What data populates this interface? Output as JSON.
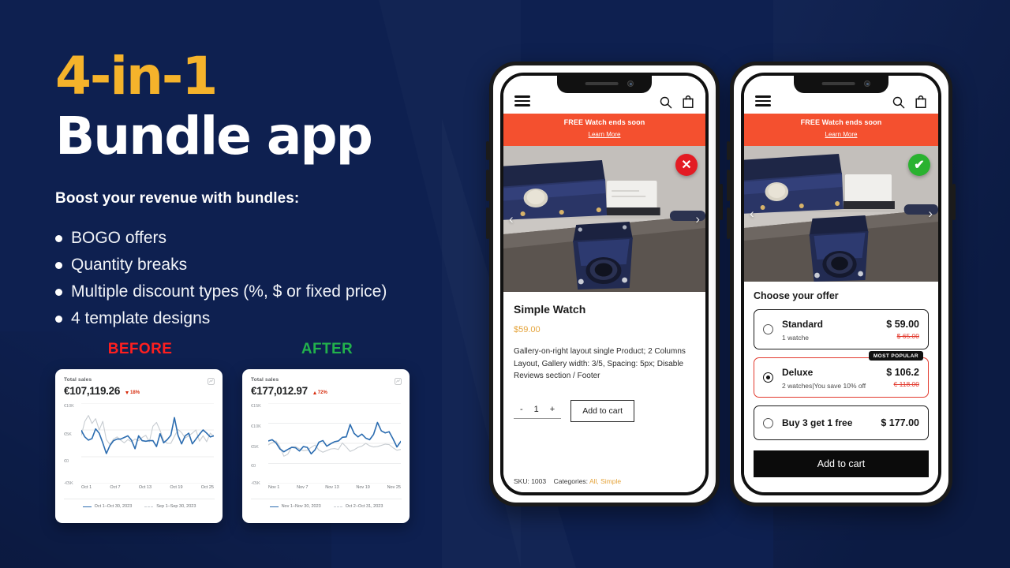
{
  "hero": {
    "headline_top": "4-in-1",
    "headline_bottom": "Bundle app",
    "subhead": "Boost your revenue with bundles:",
    "bullets": [
      "BOGO offers",
      "Quantity breaks",
      "Multiple discount types (%, $ or fixed price)",
      "4 template designs"
    ],
    "accent_yellow": "#F5B32B",
    "text_white": "#FFFFFF"
  },
  "comparison": {
    "before_label": "BEFORE",
    "after_label": "AFTER",
    "before_color": "#FF1F1F",
    "after_color": "#22B14C",
    "before_card": {
      "title": "Total sales",
      "amount": "€107,119.26",
      "delta": "18%",
      "y_ticks": [
        "€10K",
        "€5K",
        "€0",
        "-€5K"
      ],
      "x_ticks": [
        "Oct 1",
        "Oct 7",
        "Oct 13",
        "Oct 19",
        "Oct 25"
      ],
      "legend": [
        "Oct 1–Oct 30, 2023",
        "Sep 1–Sep 30, 2023"
      ]
    },
    "after_card": {
      "title": "Total sales",
      "amount": "€177,012.97",
      "delta": "72%",
      "y_ticks": [
        "€15K",
        "€10K",
        "€5K",
        "€0",
        "-€5K"
      ],
      "x_ticks": [
        "Nov 1",
        "Nov 7",
        "Nov 13",
        "Nov 19",
        "Nov 25"
      ],
      "legend": [
        "Nov 1–Nov 30, 2023",
        "Oct 2–Oct 31, 2023"
      ]
    }
  },
  "chart_data": [
    {
      "type": "line",
      "title": "Total sales",
      "subtitle": "€107,119.26",
      "xlabel": "",
      "ylabel": "",
      "ylim": [
        -5000,
        10000
      ],
      "y_ticks": [
        10000,
        5000,
        0,
        -5000
      ],
      "y_ticklabels": [
        "€10K",
        "€5K",
        "€0",
        "-€5K"
      ],
      "x_ticklabels": [
        "Oct 1",
        "Oct 7",
        "Oct 13",
        "Oct 19",
        "Oct 25"
      ],
      "grid": true,
      "legend": "bottom",
      "series": [
        {
          "name": "Oct 1–Oct 30, 2023",
          "color": "#2B6CB0",
          "values": [
            4900,
            3700,
            3100,
            3400,
            5200,
            4400,
            2600,
            600,
            2100,
            3000,
            3300,
            3300,
            3600,
            3900,
            3100,
            1500,
            3900,
            3000,
            2900,
            3000,
            3000,
            1900,
            4300,
            2600,
            3200,
            4000,
            7300,
            4000,
            2400,
            3900,
            4400,
            2400,
            3300,
            4200,
            5000,
            4400,
            3700,
            3900
          ]
        },
        {
          "name": "Sep 1–Sep 30, 2023",
          "color": "#C7CCD1",
          "values": [
            4000,
            6600,
            7700,
            6200,
            7100,
            5000,
            6600,
            3200,
            2300,
            3300,
            3700,
            3100,
            2600,
            3200,
            2800,
            3300,
            3000,
            3600,
            4000,
            2800,
            5700,
            6400,
            4900,
            3000,
            2500,
            2500,
            3800,
            5100,
            4500,
            3500,
            3900,
            4400,
            5000,
            2900,
            3900,
            2800,
            4400,
            3800
          ]
        }
      ]
    },
    {
      "type": "line",
      "title": "Total sales",
      "subtitle": "€177,012.97",
      "xlabel": "",
      "ylabel": "",
      "ylim": [
        -5000,
        15000
      ],
      "y_ticks": [
        15000,
        10000,
        5000,
        0,
        -5000
      ],
      "y_ticklabels": [
        "€15K",
        "€10K",
        "€5K",
        "€0",
        "-€5K"
      ],
      "x_ticklabels": [
        "Nov 1",
        "Nov 7",
        "Nov 13",
        "Nov 19",
        "Nov 25"
      ],
      "grid": true,
      "legend": "bottom",
      "series": [
        {
          "name": "Nov 1–Nov 30, 2023",
          "color": "#2B6CB0",
          "values": [
            5600,
            5900,
            5100,
            3600,
            2900,
            3500,
            4000,
            3900,
            3100,
            4200,
            4000,
            2400,
            3400,
            5300,
            5700,
            4300,
            4900,
            5400,
            5600,
            6500,
            6600,
            9700,
            7500,
            6600,
            7300,
            6300,
            5900,
            7200,
            10200,
            8100,
            7600,
            7900,
            6100,
            4100,
            5500
          ]
        },
        {
          "name": "Oct 2–Oct 31, 2023",
          "color": "#C7CCD1",
          "values": [
            4600,
            5200,
            5600,
            4100,
            1800,
            2300,
            4100,
            4200,
            3600,
            3200,
            3300,
            4000,
            4600,
            3300,
            2800,
            3200,
            3600,
            3700,
            3500,
            5100,
            4100,
            3000,
            3400,
            4000,
            4300,
            5000,
            4400,
            4100,
            4200,
            4500,
            4800,
            4700,
            3900,
            3300,
            3500
          ]
        }
      ]
    }
  ],
  "phone_left": {
    "icons": {
      "menu": "hamburger-icon",
      "search": "search-icon",
      "cart": "shopping-bag-icon"
    },
    "promo": {
      "text": "FREE Watch ends soon",
      "link": "Learn More",
      "bg": "#F4502F"
    },
    "badge": {
      "kind": "error",
      "glyph": "✕",
      "color": "#E31B23"
    },
    "gallery": {
      "prev": "‹",
      "next": "›"
    },
    "product": {
      "title": "Simple Watch",
      "price": "$59.00",
      "description": "Gallery-on-right layout single Product;  2 Columns Layout, Gallery width: 3/5, Spacing: 5px; Disable Reviews section / Footer"
    },
    "quantity": {
      "minus": "-",
      "value": "1",
      "plus": "+"
    },
    "add_to_cart": "Add to cart",
    "meta": {
      "sku_label": "SKU: 1003",
      "categories_label": "Categories:",
      "categories": "All, Simple"
    }
  },
  "phone_right": {
    "icons": {
      "menu": "hamburger-icon",
      "search": "search-icon",
      "cart": "shopping-bag-icon"
    },
    "promo": {
      "text": "FREE Watch ends soon",
      "link": "Learn More",
      "bg": "#F4502F"
    },
    "badge": {
      "kind": "success",
      "glyph": "✔",
      "color": "#2AB230"
    },
    "gallery": {
      "prev": "‹",
      "next": "›"
    },
    "offers_title": "Choose your offer",
    "offers": [
      {
        "name": "Standard",
        "sub": "1 watche",
        "price": "$ 59.00",
        "old_price": "$ 65.00",
        "selected": false,
        "badge": ""
      },
      {
        "name": "Deluxe",
        "sub": "2 watches|You save 10% off",
        "price": "$ 106.2",
        "old_price": "€ 118.00",
        "selected": true,
        "badge": "MOST POPULAR"
      },
      {
        "name": "Buy 3 get 1 free",
        "sub": "",
        "price": "$ 177.00",
        "old_price": "",
        "selected": false,
        "badge": ""
      }
    ],
    "add_to_cart": "Add to cart"
  }
}
